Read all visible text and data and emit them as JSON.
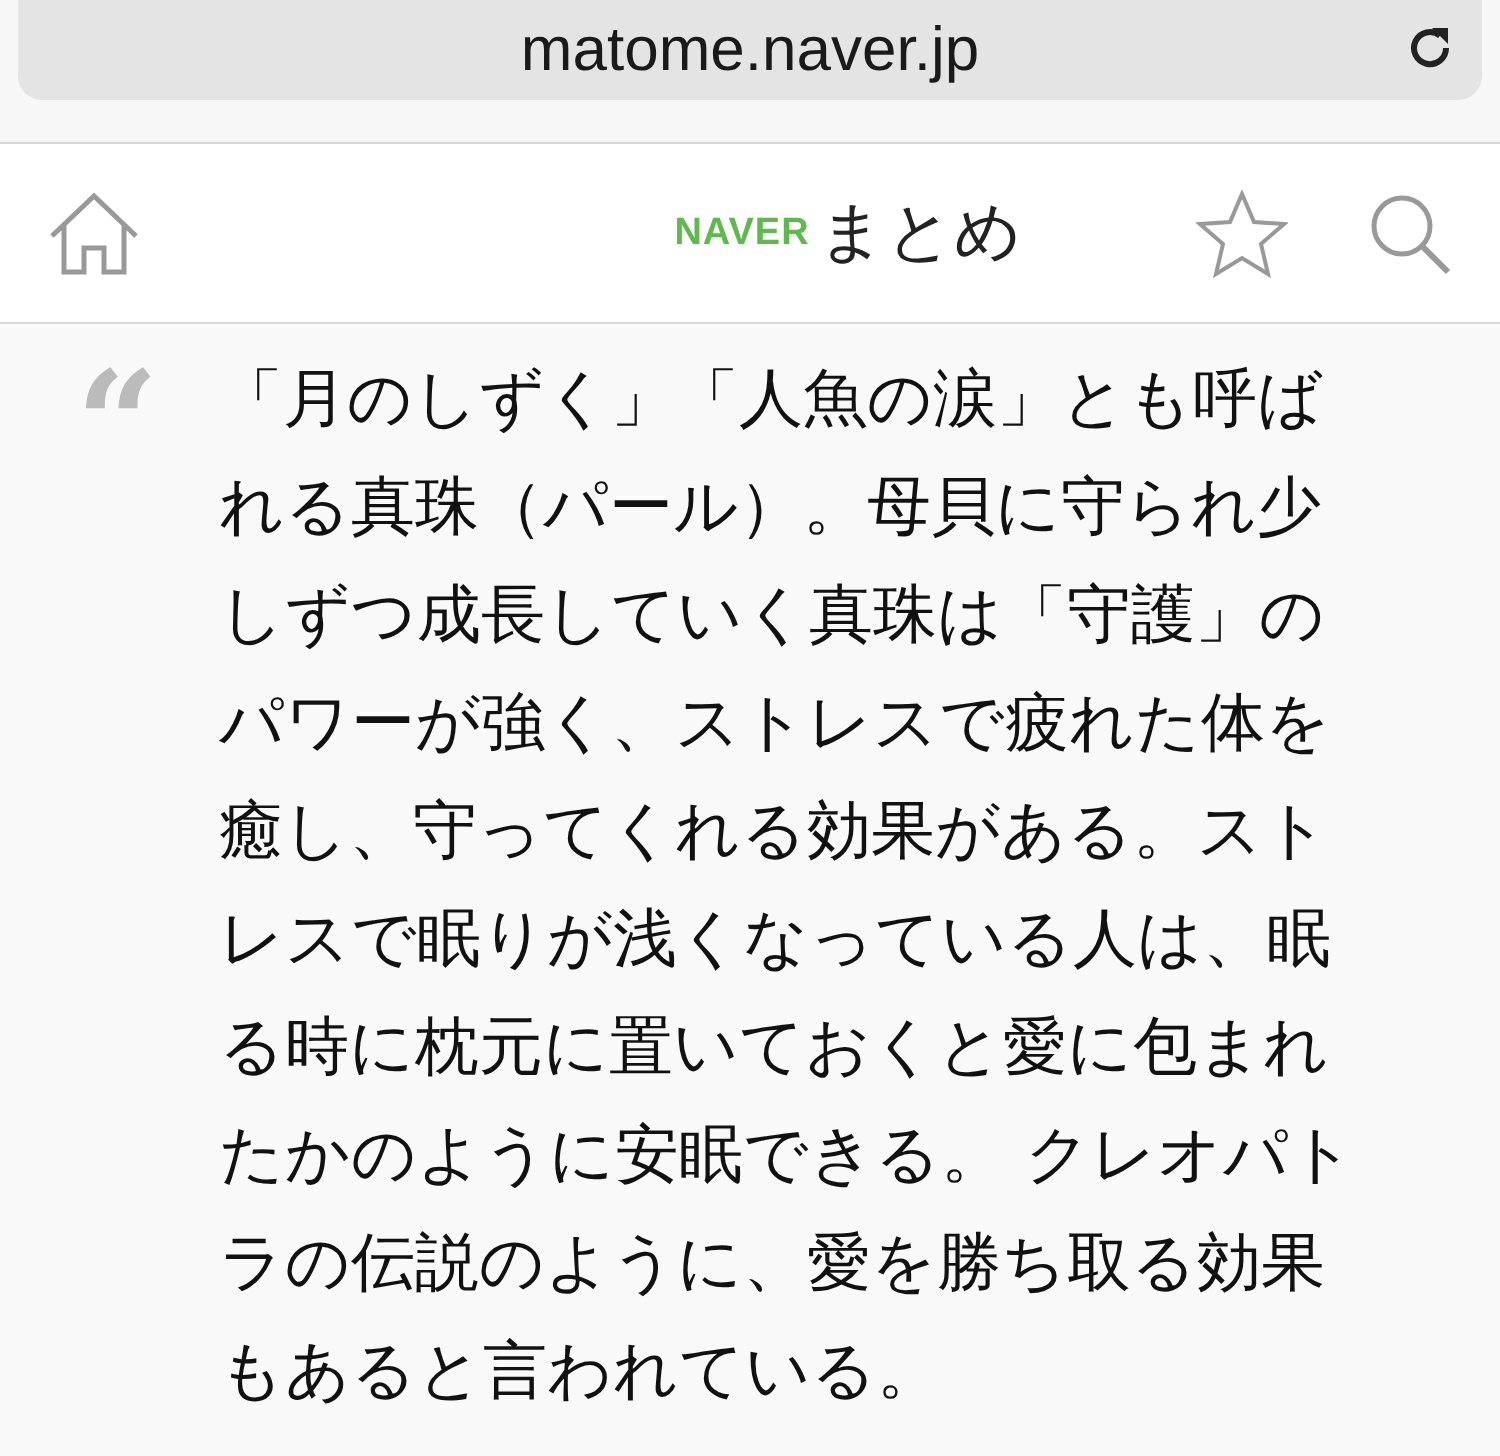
{
  "address_bar": {
    "url": "matome.naver.jp"
  },
  "nav": {
    "logo_brand": "NAVER",
    "logo_title": "まとめ"
  },
  "quote": {
    "mark": "“",
    "text": "「月のしずく」「人魚の涙」とも呼ばれる真珠（パール）。母貝に守られ少しずつ成長していく真珠は「守護」のパワーが強く、ストレスで疲れた体を癒し、守ってくれる効果がある。ストレスで眠りが浅くなっている人は、眠る時に枕元に置いておくと愛に包まれたかのように安眠できる。 クレオパトラの伝説のように、愛を勝ち取る効果もあると言われている。"
  }
}
